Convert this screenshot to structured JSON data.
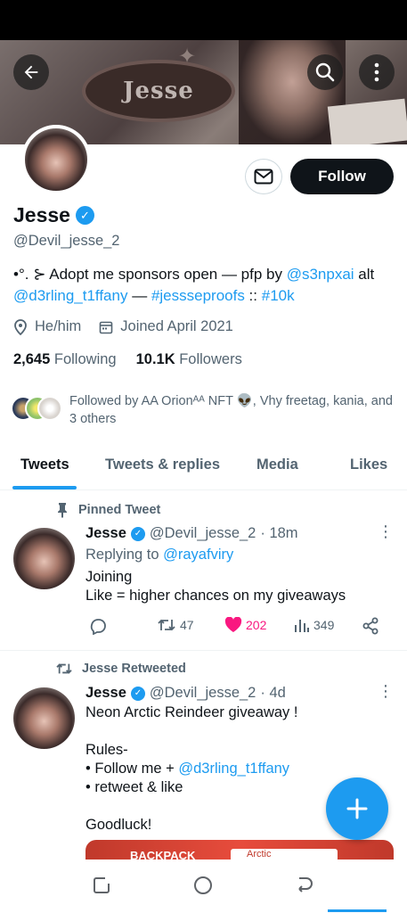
{
  "profile": {
    "banner_text": "Jesse",
    "name": "Jesse",
    "handle": "@Devil_jesse_2",
    "bio_prefix": "•°. ⊱ Adopt me sponsors open — pfp by ",
    "bio_mention1": "@s3npxai",
    "bio_alt": " alt",
    "bio_mention2": "@d3rling_t1ffany",
    "bio_dash": " — ",
    "bio_hashtag": "#jessseproofs",
    "bio_sep": " :: ",
    "bio_hashtag2": "#10k",
    "pronouns": "He/him",
    "joined": "Joined April 2021",
    "following_count": "2,645",
    "following_label": "Following",
    "followers_count": "10.1K",
    "followers_label": "Followers",
    "followed_by": "Followed by AA Orionᴬᴬ NFT 👽, Vhy freetag, kania, and 3 others"
  },
  "header": {
    "follow_label": "Follow"
  },
  "tabs": [
    {
      "label": "Tweets",
      "active": true
    },
    {
      "label": "Tweets & replies",
      "active": false
    },
    {
      "label": "Media",
      "active": false
    },
    {
      "label": "Likes",
      "active": false
    }
  ],
  "tweets": [
    {
      "context": "Pinned Tweet",
      "name": "Jesse",
      "handle": "@Devil_jesse_2",
      "time": "· 18m",
      "replying_prefix": "Replying to ",
      "replying_to": "@rayafviry",
      "line1": "Joining",
      "line2": "Like = higher chances on my giveaways",
      "retweets": "47",
      "likes": "202",
      "views": "349"
    },
    {
      "context": "Jesse Retweeted",
      "name": "Jesse",
      "handle": "@Devil_jesse_2",
      "time": "· 4d",
      "line1": "Neon Arctic Reindeer giveaway !",
      "line2": "Rules-",
      "line3_prefix": "• Follow me + ",
      "line3_mention": "@d3rling_t1ffany",
      "line4": "• retweet & like",
      "line5": "Goodluck!",
      "media_label": "BACKPACK",
      "media_search": "Arctic"
    }
  ],
  "colors": {
    "accent": "#1d9bf0",
    "like": "#f91880",
    "text": "#0f1419",
    "muted": "#536471"
  }
}
